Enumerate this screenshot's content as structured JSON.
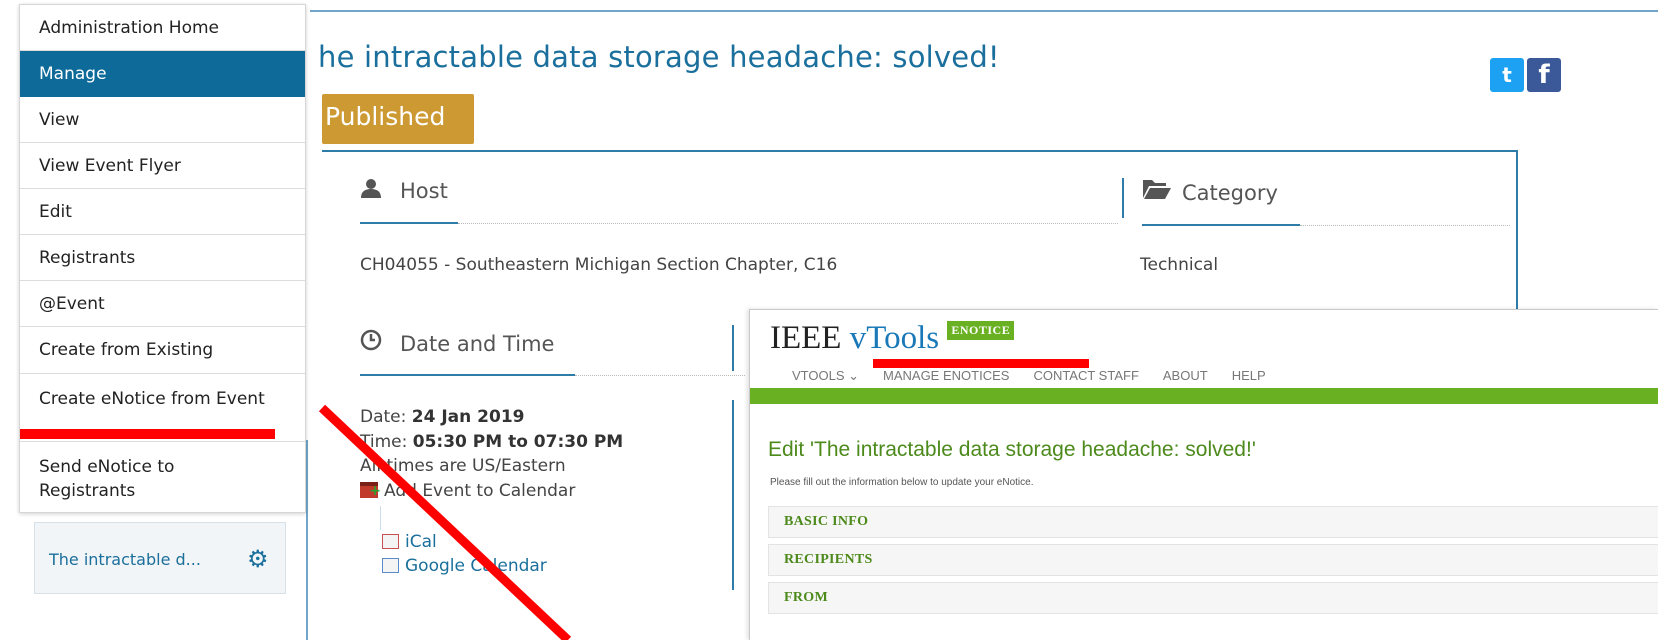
{
  "event": {
    "title": "he intractable data storage headache: solved!",
    "status": "Published",
    "share_icons": [
      "twitter-icon",
      "facebook-icon"
    ]
  },
  "sections": {
    "host": {
      "heading": "Host",
      "value": "CH04055 - Southeastern Michigan Section Chapter, C16"
    },
    "category": {
      "heading": "Category",
      "value": "Technical"
    },
    "datetime": {
      "heading": "Date and Time",
      "date_label": "Date: ",
      "date_value": "24 Jan 2019",
      "time_label": "Time: ",
      "time_value": "05:30 PM to 07:30 PM",
      "timezone_note": "All times are US/Eastern",
      "add_calendar": "Add Event to Calendar",
      "ical": "iCal",
      "google_calendar": "Google Calendar"
    }
  },
  "menu": {
    "items": [
      "Administration Home",
      "Manage",
      "View",
      "View Event Flyer",
      "Edit",
      "Registrants",
      "@Event",
      "Create from Existing",
      "Create eNotice from Event",
      "Send eNotice to Registrants"
    ],
    "active": "Manage"
  },
  "side_widget": {
    "label": "The intractable d...",
    "icon": "gear-icon"
  },
  "vtools": {
    "brand_ieee": "IEEE",
    "brand_vtools": "vTools",
    "badge": "ENOTICE",
    "nav": [
      "VTOOLS ⌄",
      "MANAGE ENOTICES",
      "CONTACT STAFF",
      "ABOUT",
      "HELP"
    ],
    "edit_title": "Edit 'The intractable data storage headache: solved!'",
    "subtitle": "Please fill out the information below to update your eNotice.",
    "sections": [
      "BASIC INFO",
      "RECIPIENTS",
      "FROM"
    ]
  },
  "colors": {
    "accent_blue": "#0e6a99",
    "published_gold": "#cc9933",
    "vtools_green": "#6ab023",
    "annotation_red": "#ff0000"
  }
}
